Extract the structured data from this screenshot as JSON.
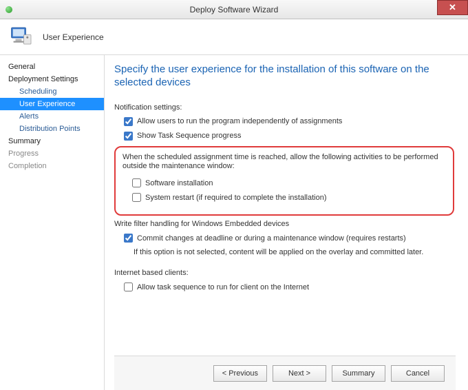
{
  "window": {
    "title": "Deploy Software Wizard"
  },
  "banner": {
    "title": "User Experience"
  },
  "sidebar": {
    "items": [
      {
        "label": "General"
      },
      {
        "label": "Deployment Settings"
      },
      {
        "label": "Scheduling"
      },
      {
        "label": "User Experience"
      },
      {
        "label": "Alerts"
      },
      {
        "label": "Distribution Points"
      },
      {
        "label": "Summary"
      },
      {
        "label": "Progress"
      },
      {
        "label": "Completion"
      }
    ]
  },
  "main": {
    "heading": "Specify the user experience for the installation of this software on the selected devices",
    "notification_label": "Notification settings:",
    "allow_independent": "Allow users to run the program independently of assignments",
    "show_task_seq": "Show Task Sequence progress",
    "box_desc": "When the scheduled assignment time is reached, allow the following activities to be performed outside the maintenance window:",
    "software_install": "Software installation",
    "system_restart": "System restart (if required to complete the installation)",
    "write_filter_label": "Write filter handling for Windows Embedded devices",
    "commit_changes": "Commit changes at deadline or during a maintenance window (requires restarts)",
    "commit_note": "If this option is not selected, content will be applied on the overlay and committed later.",
    "internet_label": "Internet based clients:",
    "allow_internet": "Allow task sequence to run for client on the Internet"
  },
  "buttons": {
    "previous": "< Previous",
    "next": "Next >",
    "summary": "Summary",
    "cancel": "Cancel"
  }
}
